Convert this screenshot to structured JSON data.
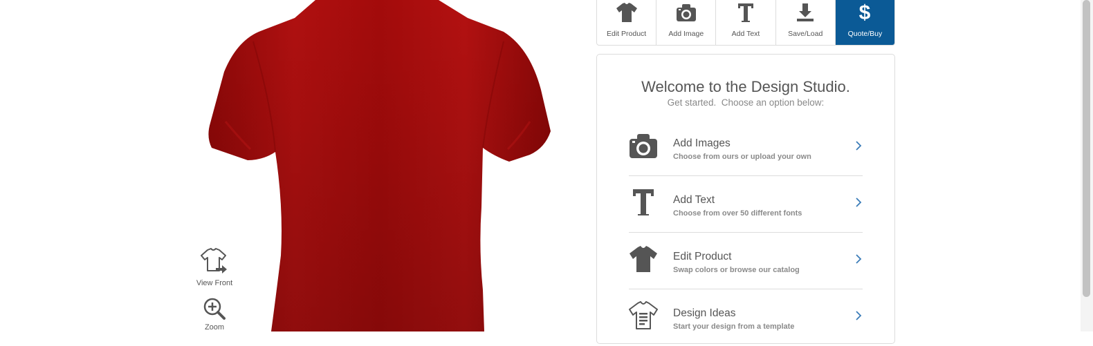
{
  "canvas": {
    "shirt_color": "#a30b0b",
    "tools": [
      {
        "label": "View Front",
        "icon": "view-front-icon"
      },
      {
        "label": "Zoom",
        "icon": "zoom-in-icon"
      }
    ]
  },
  "toolbar": {
    "buttons": [
      {
        "label": "Edit Product",
        "icon": "tshirt-icon"
      },
      {
        "label": "Add Image",
        "icon": "camera-icon"
      },
      {
        "label": "Add Text",
        "icon": "text-icon"
      },
      {
        "label": "Save/Load",
        "icon": "download-icon"
      },
      {
        "label": "Quote/Buy",
        "icon": "dollar-icon",
        "active": true
      }
    ],
    "accent": "#0b5a96"
  },
  "welcome": {
    "title": "Welcome to the Design Studio.",
    "subtitle": "Get started.  Choose an option below:",
    "options": [
      {
        "title": "Add Images",
        "desc": "Choose from ours or upload your own",
        "icon": "camera-icon"
      },
      {
        "title": "Add Text",
        "desc": "Choose from over 50 different fonts",
        "icon": "text-icon"
      },
      {
        "title": "Edit Product",
        "desc": "Swap colors or browse our catalog",
        "icon": "tshirt-icon"
      },
      {
        "title": "Design Ideas",
        "desc": "Start your design from a template",
        "icon": "template-shirt-icon"
      }
    ]
  }
}
